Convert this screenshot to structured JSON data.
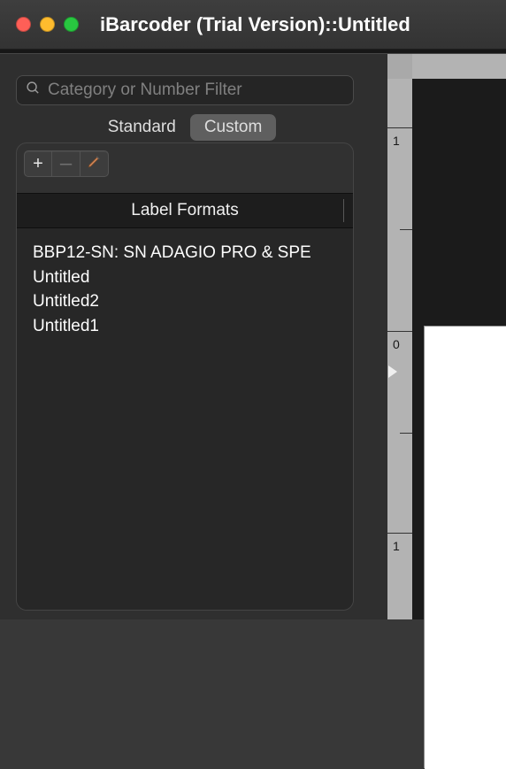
{
  "window": {
    "title": "iBarcoder (Trial Version)::Untitled"
  },
  "sidebar": {
    "search_placeholder": "Category or Number Filter",
    "tabs": {
      "standard": "Standard",
      "custom": "Custom",
      "active": "custom"
    },
    "toolbar": {
      "add": "+",
      "remove": "–"
    },
    "header": "Label Formats",
    "formats": [
      "BBP12-SN: SN ADAGIO PRO & SPE",
      "Untitled",
      "Untitled2",
      "Untitled1"
    ]
  },
  "ruler": {
    "v_ticks": [
      "1",
      "0",
      "1"
    ]
  }
}
